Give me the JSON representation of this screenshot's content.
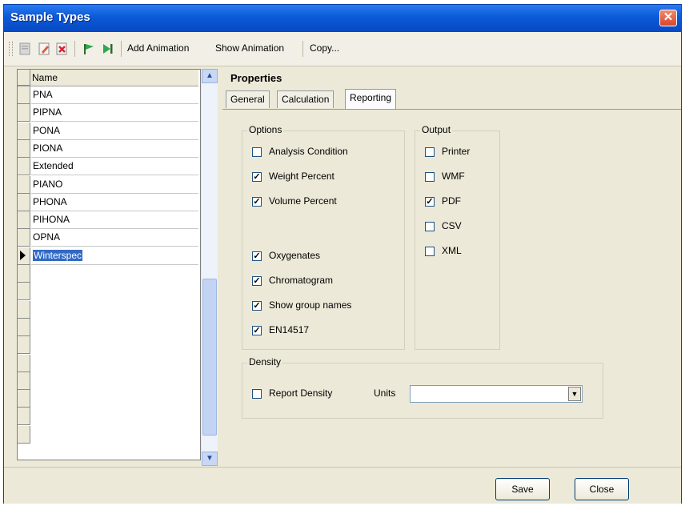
{
  "window": {
    "title": "Sample Types",
    "close_glyph": "✕"
  },
  "toolbar": {
    "icons": [
      "new-icon",
      "edit-icon",
      "delete-icon",
      "flag-start-icon",
      "flag-end-icon"
    ],
    "add_animation": "Add Animation",
    "show_animation": "Show Animation",
    "copy": "Copy..."
  },
  "grid": {
    "header": "Name",
    "rows": [
      "PNA",
      "PIPNA",
      "PONA",
      "PIONA",
      "Extended",
      "PIANO",
      "PHONA",
      "PIHONA",
      "OPNA",
      "Winterspec"
    ],
    "selected": "Winterspec"
  },
  "properties": {
    "title": "Properties",
    "tabs": [
      "General",
      "Calculation",
      "Reporting"
    ],
    "active_tab": "Reporting",
    "options": {
      "label": "Options",
      "items": [
        {
          "label": "Analysis Condition",
          "checked": false
        },
        {
          "label": "Weight Percent",
          "checked": true
        },
        {
          "label": "Volume Percent",
          "checked": true
        },
        {
          "label": "Oxygenates",
          "checked": true
        },
        {
          "label": "Chromatogram",
          "checked": true
        },
        {
          "label": "Show group names",
          "checked": true
        },
        {
          "label": "EN14517",
          "checked": true
        }
      ]
    },
    "output": {
      "label": "Output",
      "items": [
        {
          "label": "Printer",
          "checked": false
        },
        {
          "label": "WMF",
          "checked": false
        },
        {
          "label": "PDF",
          "checked": true
        },
        {
          "label": "CSV",
          "checked": false
        },
        {
          "label": "XML",
          "checked": false
        }
      ]
    },
    "density": {
      "label": "Density",
      "report_density": {
        "label": "Report Density",
        "checked": false
      },
      "units_label": "Units",
      "units_value": ""
    }
  },
  "buttons": {
    "save": "Save",
    "close": "Close"
  }
}
